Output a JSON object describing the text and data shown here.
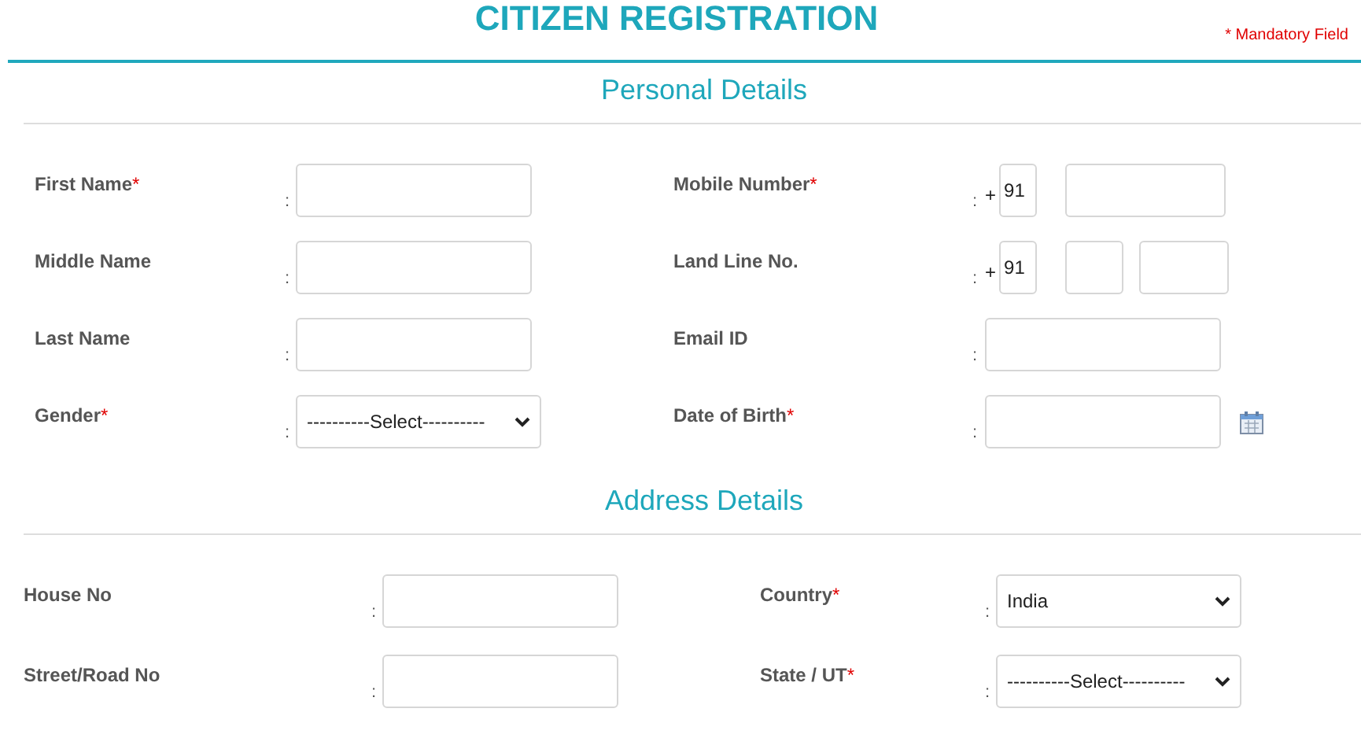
{
  "title": "CITIZEN REGISTRATION",
  "mandatory_note": "* Mandatory Field",
  "sections": [
    {
      "heading": "Personal Details",
      "rows": [
        [
          {
            "kind": "text",
            "label": "First Name",
            "mark": "*",
            "separator": ":"
          },
          {
            "kind": "phone",
            "label": "Mobile Number",
            "mark": "*",
            "separator": ":",
            "prefix": "+",
            "code": "91"
          }
        ],
        [
          {
            "kind": "text",
            "label": "Middle Name",
            "separator": ":"
          },
          {
            "kind": "landline",
            "label": "Land Line No.",
            "separator": ":",
            "prefix": "+",
            "code": "91"
          }
        ],
        [
          {
            "kind": "text",
            "label": "Last Name",
            "separator": ":"
          },
          {
            "kind": "text",
            "label": "Email ID",
            "separator": ":"
          }
        ],
        [
          {
            "kind": "select",
            "label": "Gender",
            "mark": "*",
            "separator": ":",
            "value": "----------Select----------"
          },
          {
            "kind": "date",
            "label": "Date of Birth",
            "mark": "*",
            "separator": ":"
          }
        ]
      ]
    },
    {
      "heading": "Address Details",
      "rows": [
        [
          {
            "kind": "text",
            "label": "House No",
            "separator": ":"
          },
          {
            "kind": "select",
            "label": "Country",
            "mark": "*",
            "separator": ":",
            "value": "India"
          }
        ],
        [
          {
            "kind": "text",
            "label": "Street/Road No",
            "separator": ":"
          },
          {
            "kind": "select",
            "label": "State / UT",
            "mark": "*",
            "separator": ":",
            "value": "----------Select----------"
          }
        ]
      ]
    }
  ]
}
